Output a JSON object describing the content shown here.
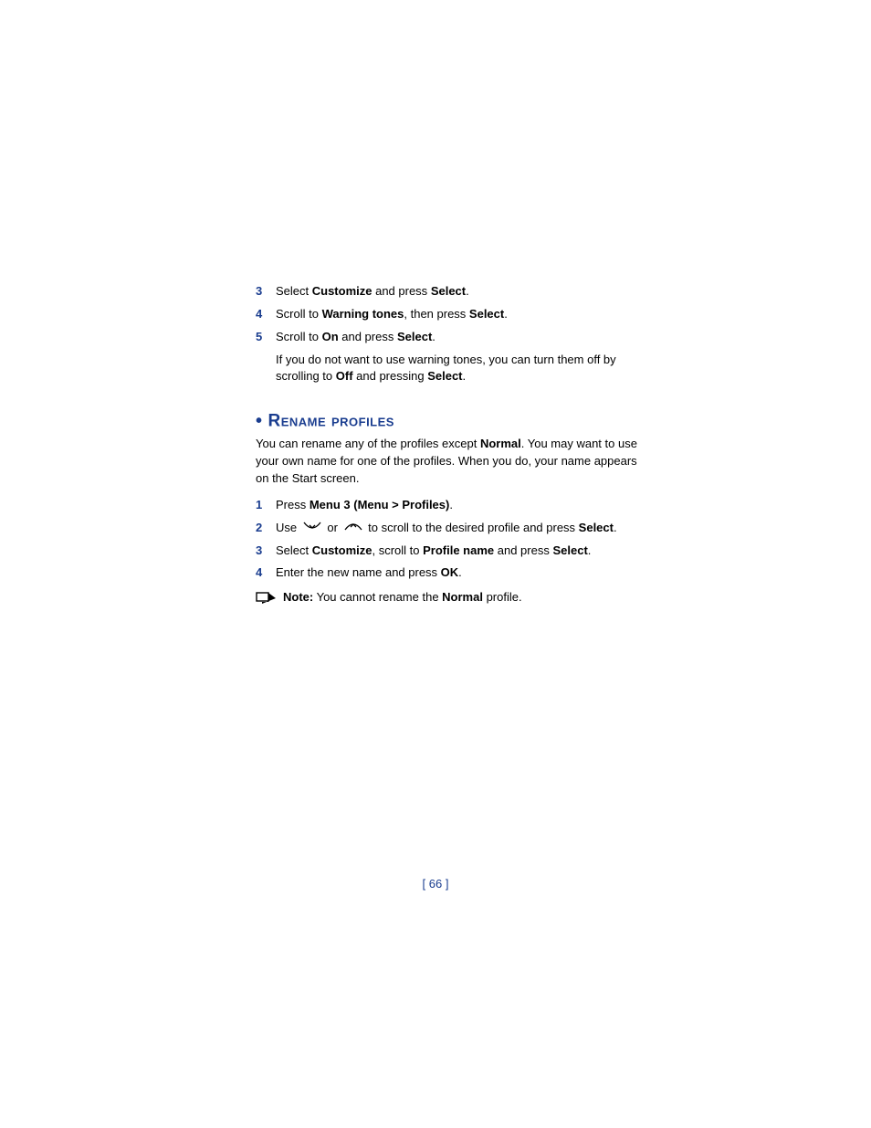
{
  "steps_a": [
    {
      "num": "3",
      "pre": "Select ",
      "b1": "Customize",
      "mid": " and press ",
      "b2": "Select",
      "post": "."
    },
    {
      "num": "4",
      "pre": "Scroll to ",
      "b1": "Warning tones",
      "mid": ", then press ",
      "b2": "Select",
      "post": "."
    },
    {
      "num": "5",
      "pre": "Scroll to ",
      "b1": "On",
      "mid": " and press ",
      "b2": "Select",
      "post": "."
    }
  ],
  "followup": {
    "pre": "If you do not want to use warning tones, you can turn them off by scrolling to ",
    "b1": "Off",
    "mid": " and pressing ",
    "b2": "Select",
    "post": "."
  },
  "heading": "Rename profiles",
  "intro": {
    "pre": "You can rename any of the profiles except ",
    "b1": "Normal",
    "post": ". You may want to use your own name for one of the profiles. When you do, your name appears on the Start screen."
  },
  "steps_b": {
    "s1": {
      "num": "1",
      "pre": "Press ",
      "b1": "Menu 3",
      "paren": " (Menu > Profiles)",
      "post": "."
    },
    "s2": {
      "num": "2",
      "pre": "Use ",
      "mid": " or ",
      "tail_pre": " to scroll to the desired profile and press ",
      "b1": "Select",
      "post": "."
    },
    "s3": {
      "num": "3",
      "pre": "Select ",
      "b1": "Customize",
      "mid": ", scroll to ",
      "b2": "Profile name",
      "mid2": " and press ",
      "b3": "Select",
      "post": "."
    },
    "s4": {
      "num": "4",
      "pre": "Enter the new name and press ",
      "b1": "OK",
      "post": "."
    }
  },
  "note": {
    "label": "Note:",
    "pre": "  You cannot rename the ",
    "b1": "Normal",
    "post": " profile."
  },
  "page_number": "[ 66 ]"
}
